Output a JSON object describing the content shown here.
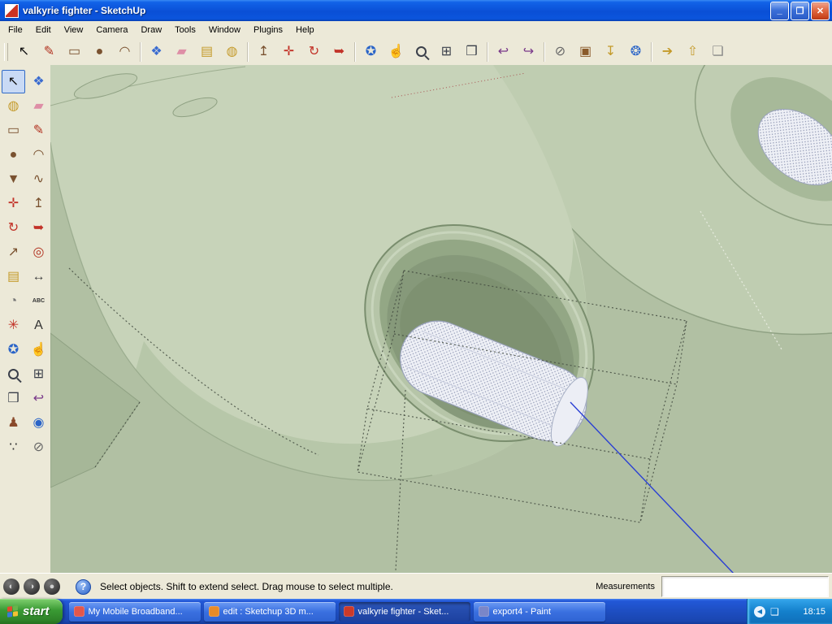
{
  "window": {
    "title": "valkyrie fighter - SketchUp"
  },
  "titlebar": {
    "minimize_glyph": "_",
    "maximize_glyph": "❐",
    "close_glyph": "✕"
  },
  "menu": {
    "items": [
      "File",
      "Edit",
      "View",
      "Camera",
      "Draw",
      "Tools",
      "Window",
      "Plugins",
      "Help"
    ]
  },
  "top_toolbar": {
    "groups": [
      {
        "items": [
          {
            "name": "select",
            "glyph": "↖",
            "color": "#111111"
          },
          {
            "name": "line",
            "glyph": "✎",
            "color": "#b23220"
          },
          {
            "name": "rectangle",
            "glyph": "▭",
            "color": "#7a5230"
          },
          {
            "name": "circle",
            "glyph": "●",
            "color": "#7a5230"
          },
          {
            "name": "arc",
            "glyph": "◠",
            "color": "#7a5230"
          }
        ]
      },
      {
        "items": [
          {
            "name": "make-component",
            "glyph": "❖",
            "color": "#3a6bd0"
          },
          {
            "name": "eraser",
            "glyph": "▰",
            "color": "#de8ea6"
          },
          {
            "name": "tape-measure",
            "glyph": "▤",
            "color": "#c49a2a"
          },
          {
            "name": "paint-bucket",
            "glyph": "◍",
            "color": "#c49a2a"
          }
        ]
      },
      {
        "items": [
          {
            "name": "push-pull",
            "glyph": "↥",
            "color": "#7a5230"
          },
          {
            "name": "move",
            "glyph": "✛",
            "color": "#c23228"
          },
          {
            "name": "rotate",
            "glyph": "↻",
            "color": "#c23228"
          },
          {
            "name": "follow-me",
            "glyph": "➥",
            "color": "#c23228"
          }
        ]
      },
      {
        "items": [
          {
            "name": "orbit",
            "glyph": "✪",
            "color": "#2a64c8"
          },
          {
            "name": "pan",
            "glyph": "☝",
            "color": "#c89a50"
          },
          {
            "name": "zoom",
            "glyph": "@zoom",
            "color": "#3a3f4a"
          },
          {
            "name": "zoom-window",
            "glyph": "⊞",
            "color": "#3a3f4a"
          },
          {
            "name": "zoom-extents",
            "glyph": "❒",
            "color": "#3a3f4a"
          }
        ]
      },
      {
        "items": [
          {
            "name": "previous-view",
            "glyph": "↩",
            "color": "#7a3a8a"
          },
          {
            "name": "next-view",
            "glyph": "↪",
            "color": "#7a3a8a"
          }
        ]
      },
      {
        "items": [
          {
            "name": "section-plane",
            "glyph": "⊘",
            "color": "#666666"
          },
          {
            "name": "3d-warehouse",
            "glyph": "▣",
            "color": "#8a5a2a"
          },
          {
            "name": "get-models",
            "glyph": "↧",
            "color": "#c49a2a"
          },
          {
            "name": "google-earth",
            "glyph": "❂",
            "color": "#2a64c8"
          }
        ]
      },
      {
        "items": [
          {
            "name": "import-model",
            "glyph": "➔",
            "color": "#c49a2a"
          },
          {
            "name": "export-model",
            "glyph": "⇧",
            "color": "#c49a2a"
          },
          {
            "name": "share-model",
            "glyph": "❏",
            "color": "#888888"
          }
        ]
      }
    ]
  },
  "left_toolbar": {
    "items": [
      {
        "name": "select",
        "glyph": "↖",
        "color": "#111111",
        "active": true
      },
      {
        "name": "make-component",
        "glyph": "❖",
        "color": "#3a6bd0"
      },
      {
        "name": "paint-bucket",
        "glyph": "◍",
        "color": "#c49a2a"
      },
      {
        "name": "eraser",
        "glyph": "▰",
        "color": "#de8ea6"
      },
      {
        "name": "rectangle",
        "glyph": "▭",
        "color": "#7a5230"
      },
      {
        "name": "line",
        "glyph": "✎",
        "color": "#b23220"
      },
      {
        "name": "circle",
        "glyph": "●",
        "color": "#7a5230"
      },
      {
        "name": "arc",
        "glyph": "◠",
        "color": "#7a5230"
      },
      {
        "name": "polygon",
        "glyph": "▼",
        "color": "#7a5230"
      },
      {
        "name": "freehand",
        "glyph": "∿",
        "color": "#7a5230"
      },
      {
        "name": "move",
        "glyph": "✛",
        "color": "#c23228"
      },
      {
        "name": "push-pull",
        "glyph": "↥",
        "color": "#7a5230"
      },
      {
        "name": "rotate",
        "glyph": "↻",
        "color": "#c23228"
      },
      {
        "name": "follow-me",
        "glyph": "➥",
        "color": "#c23228"
      },
      {
        "name": "scale",
        "glyph": "↗",
        "color": "#7a5230"
      },
      {
        "name": "offset",
        "glyph": "◎",
        "color": "#b23220"
      },
      {
        "name": "tape-measure",
        "glyph": "▤",
        "color": "#c49a2a"
      },
      {
        "name": "dimension",
        "glyph": "↔",
        "color": "#444444"
      },
      {
        "name": "protractor",
        "glyph": "◔",
        "color": "#777777"
      },
      {
        "name": "text",
        "glyph": "ABC",
        "color": "#333333"
      },
      {
        "name": "axes",
        "glyph": "✳",
        "color": "#c23228"
      },
      {
        "name": "3d-text",
        "glyph": "A",
        "color": "#333333"
      },
      {
        "name": "orbit",
        "glyph": "✪",
        "color": "#2a64c8"
      },
      {
        "name": "pan",
        "glyph": "☝",
        "color": "#c89a50"
      },
      {
        "name": "zoom",
        "glyph": "@zoom",
        "color": "#3a3f4a"
      },
      {
        "name": "zoom-window",
        "glyph": "⊞",
        "color": "#3a3f4a"
      },
      {
        "name": "zoom-extents",
        "glyph": "❒",
        "color": "#3a3f4a"
      },
      {
        "name": "previous-view",
        "glyph": "↩",
        "color": "#7a3a8a"
      },
      {
        "name": "position-camera",
        "glyph": "♟",
        "color": "#8a4a2a"
      },
      {
        "name": "look-around",
        "glyph": "◉",
        "color": "#2a64c8"
      },
      {
        "name": "walk",
        "glyph": "∵",
        "color": "#333333"
      },
      {
        "name": "section-plane",
        "glyph": "⊘",
        "color": "#666666"
      }
    ]
  },
  "statusbar": {
    "icons": [
      {
        "name": "geolocation-status",
        "glyph": "◐"
      },
      {
        "name": "credits-status",
        "glyph": "◑"
      },
      {
        "name": "sketchup-status",
        "glyph": "●"
      }
    ],
    "help_glyph": "?",
    "hint": "Select objects. Shift to extend select. Drag mouse to select multiple.",
    "measurements_label": "Measurements",
    "measurements_value": ""
  },
  "taskbar": {
    "start_label": "start",
    "items": [
      {
        "name": "task-mobile-broadband",
        "label": "My Mobile Broadband...",
        "active": false,
        "icon_color": "#e2574c"
      },
      {
        "name": "task-browser-sketchup",
        "label": "edit : Sketchup 3D m...",
        "active": false,
        "icon_color": "#e88b28"
      },
      {
        "name": "task-sketchup",
        "label": "valkyrie fighter - Sket...",
        "active": true,
        "icon_color": "#cc3a2a"
      },
      {
        "name": "task-paint",
        "label": "export4 - Paint",
        "active": false,
        "icon_color": "#7a86c8"
      }
    ],
    "tray": {
      "time": "18:15"
    }
  },
  "colors": {
    "titlebar_blue": "#0a4fd6",
    "taskbar_blue": "#1e4fc4",
    "start_green": "#3a9a34",
    "viewport_background": "#b1c0a3",
    "model_surface_light": "#c7d3b9",
    "axis_blue": "#2a3fd4"
  }
}
